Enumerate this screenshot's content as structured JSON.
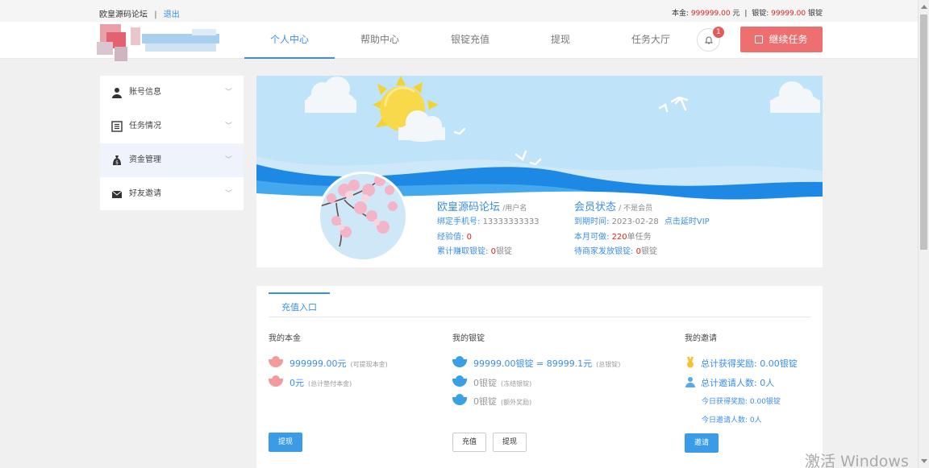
{
  "topbar": {
    "site_name": "欧皇源码论坛",
    "separator": "|",
    "logout": "退出",
    "principal_label": "本金:",
    "principal_value": "999999.00",
    "principal_unit": "元",
    "ingot_label": "银锭:",
    "ingot_value": "99999.00",
    "ingot_unit": "银锭"
  },
  "nav": {
    "items": [
      "个人中心",
      "帮助中心",
      "银锭充值",
      "提现",
      "任务大厅"
    ],
    "active": "个人中心",
    "bell_badge": "1",
    "continue_button": "继续任务"
  },
  "sidebar": {
    "items": [
      {
        "label": "账号信息",
        "icon": "user-icon"
      },
      {
        "label": "任务情况",
        "icon": "list-icon"
      },
      {
        "label": "资金管理",
        "icon": "money-bag-icon"
      },
      {
        "label": "好友邀请",
        "icon": "mail-icon"
      }
    ],
    "active_index": 2
  },
  "profile": {
    "name": "欧皇源码论坛",
    "name_suffix": "/用户名",
    "phone_label": "绑定手机号:",
    "phone": "13333333333",
    "exp_label": "经验值:",
    "exp": "0",
    "earned_label": "累计赚取银锭:",
    "earned": "0",
    "earned_unit": "银锭",
    "member_title": "会员状态",
    "member_status": "/ 不是会员",
    "expire_label": "到期时间:",
    "expire_date": "2023-02-28",
    "extend_link": "点击延时VIP",
    "monthly_label": "本月可做:",
    "monthly_count": "220",
    "monthly_unit": "单任务",
    "pending_label": "待商家发放银锭:",
    "pending": "0",
    "pending_unit": "银锭"
  },
  "recharge": {
    "tab": "充值入口",
    "principal_col": {
      "title": "我的本金",
      "withdrawable": "999999.00元",
      "withdrawable_note": "(可提现本金)",
      "advanced": "0元",
      "advanced_note": "(总计垫付本金)",
      "button": "提现"
    },
    "ingot_col": {
      "title": "我的银锭",
      "total": "99999.00银锭 = 89999.1元",
      "total_note": "(总银锭)",
      "frozen": "0银锭",
      "frozen_note": "(冻结银锭)",
      "bonus": "0银锭",
      "bonus_note": "(额外奖励)",
      "recharge_button": "充值",
      "withdraw_button": "提现"
    },
    "invite_col": {
      "title": "我的邀请",
      "total_reward": "总计获得奖励: 0.00银锭",
      "total_invites": "总计邀请人数: 0人",
      "today_reward": "今日获得奖励: 0.00银锭",
      "today_invites": "今日邀请人数: 0人",
      "button": "邀请"
    }
  },
  "watermark": "激活 Windows",
  "colors": {
    "accent": "#3a8ee6",
    "danger": "#ee6f6f",
    "sky": "#bfe3f8",
    "wave": "#1e88e5"
  }
}
